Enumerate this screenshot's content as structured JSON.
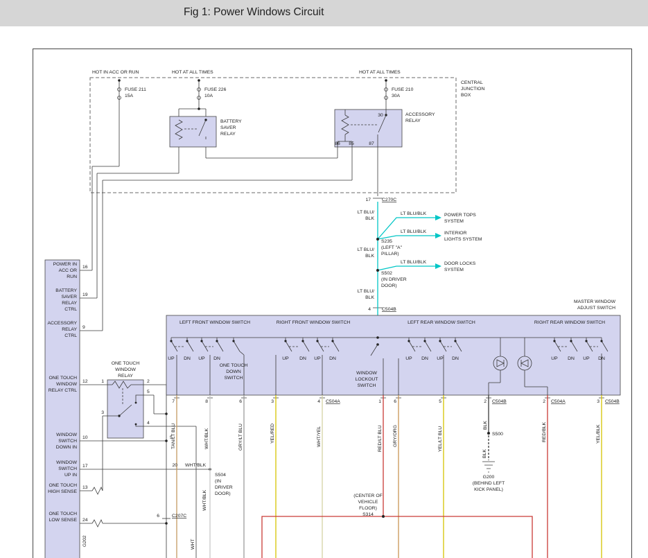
{
  "header": {
    "title": "Fig 1: Power Windows Circuit"
  },
  "colors": {
    "panel": "#d3d4ef",
    "cyan": "#00c6c6",
    "tan": "#c49a62",
    "white_wire": "#c9c9c9",
    "gray_wire": "#9b9b9b",
    "yellow": "#d6c300",
    "pale_yellow": "#d6d2a4",
    "red": "#c93a36",
    "orange": "#c99554",
    "black_wire": "#3a3a3a"
  },
  "top": {
    "feed1": "HOT IN ACC OR RUN",
    "feed2": "HOT AT ALL TIMES",
    "feed3": "HOT AT ALL TIMES",
    "fuse1": {
      "name": "FUSE 211",
      "rating": "15A"
    },
    "fuse2": {
      "name": "FUSE 226",
      "rating": "10A"
    },
    "fuse3": {
      "name": "FUSE 210",
      "rating": "30A"
    },
    "cjb": [
      "CENTRAL",
      "JUNCTION",
      "BOX"
    ],
    "bsr": [
      "BATTERY",
      "SAVER",
      "RELAY"
    ],
    "acc": [
      "ACCESSORY",
      "RELAY"
    ],
    "acc_pins": {
      "p30": "30",
      "p86": "86",
      "p85": "85",
      "p87": "87"
    }
  },
  "trunk": {
    "c270c_pin": "17",
    "c270c": "C270C",
    "w1a": "LT BLU/",
    "w1b": "BLK",
    "w2a": "LT BLU/",
    "w2b": "BLK",
    "w3a": "LT BLU/",
    "w3b": "BLK",
    "b1_wire": "LT BLU/BLK",
    "b1_dest": [
      "POWER TOPS",
      "SYSTEM"
    ],
    "b2_wire": "LT BLU/BLK",
    "b2_dest": [
      "INTERIOR",
      "LIGHTS SYSTEM"
    ],
    "b3_wire": "LT BLU/BLK",
    "b3_dest": [
      "DOOR LOCKS",
      "SYSTEM"
    ],
    "s235": [
      "S235",
      "(LEFT \"A\"",
      "PILLAR)"
    ],
    "s502": [
      "S502",
      "(IN DRIVER",
      "DOOR)"
    ],
    "c504b_pin": "4",
    "c504b": "C504B"
  },
  "msw": {
    "title": [
      "MASTER WINDOW",
      "ADJUST SWITCH"
    ],
    "sections": [
      "LEFT FRONT WINDOW SWITCH",
      "RIGHT FRONT WINDOW SWITCH",
      "LEFT REAR WINDOW SWITCH",
      "RIGHT REAR WINDOW SWITCH"
    ],
    "up": "UP",
    "dn": "DN",
    "one_touch": [
      "ONE TOUCH",
      "DOWN",
      "SWITCH"
    ],
    "lockout": [
      "WINDOW",
      "LOCKOUT",
      "SWITCH"
    ]
  },
  "out": {
    "pins": [
      "7",
      "8",
      "6",
      "3",
      "4",
      "1",
      "6",
      "5",
      "2",
      "2",
      "3"
    ],
    "connectors": [
      "C504A",
      "C504B",
      "C504A",
      "C504B"
    ],
    "wires": [
      "TAN/LT BLU",
      "WHT/BLK",
      "GRY/LT BLU",
      "YEL/RED",
      "WHT/YEL",
      "RED/LT BLU",
      "GRY/ORG",
      "YEL/LT BLU",
      "BLK",
      "RED/BLK",
      "YEL/BLK"
    ],
    "s500": "S500",
    "blk": "BLK",
    "g200": [
      "G200",
      "(BEHIND LEFT",
      "KICK PANEL)"
    ],
    "s314": [
      "(CENTER OF",
      "VEHICLE",
      "FLOOR)",
      "S314"
    ]
  },
  "module": {
    "pins": [
      {
        "num": "16",
        "label": [
          "POWER IN",
          "ACC OR",
          "RUN"
        ]
      },
      {
        "num": "19",
        "label": [
          "BATTERY",
          "SAVER",
          "RELAY",
          "CTRL"
        ]
      },
      {
        "num": "9",
        "label": [
          "ACCESSORY",
          "RELAY",
          "CTRL"
        ]
      },
      {
        "num": "12",
        "label": [
          "ONE TOUCH",
          "WINDOW",
          "RELAY CTRL"
        ]
      },
      {
        "num": "10",
        "label": [
          "WINDOW",
          "SWITCH",
          "DOWN IN"
        ]
      },
      {
        "num": "17",
        "label": [
          "WINDOW",
          "SWITCH",
          "UP IN"
        ]
      },
      {
        "num": "13",
        "label": [
          "ONE TOUCH",
          "HIGH SENSE"
        ]
      },
      {
        "num": "24",
        "label": [
          "ONE TOUCH",
          "LOW SENSE"
        ]
      }
    ],
    "g202": "G202"
  },
  "otr": {
    "title": [
      "ONE TOUCH",
      "WINDOW",
      "RELAY"
    ],
    "p1": "1",
    "p2": "2",
    "p3": "3",
    "p5": "5",
    "p4": "4"
  },
  "misc": {
    "p5_tick": "5",
    "c207c_pin": "6",
    "c207c": "C207C",
    "p20": "20",
    "wht_blk_h": "WHT/BLK",
    "wht_blk_v": "WHT/BLK",
    "wht": "WHT",
    "s504": [
      "S504",
      "(IN",
      "DRIVER",
      "DOOR)"
    ]
  }
}
